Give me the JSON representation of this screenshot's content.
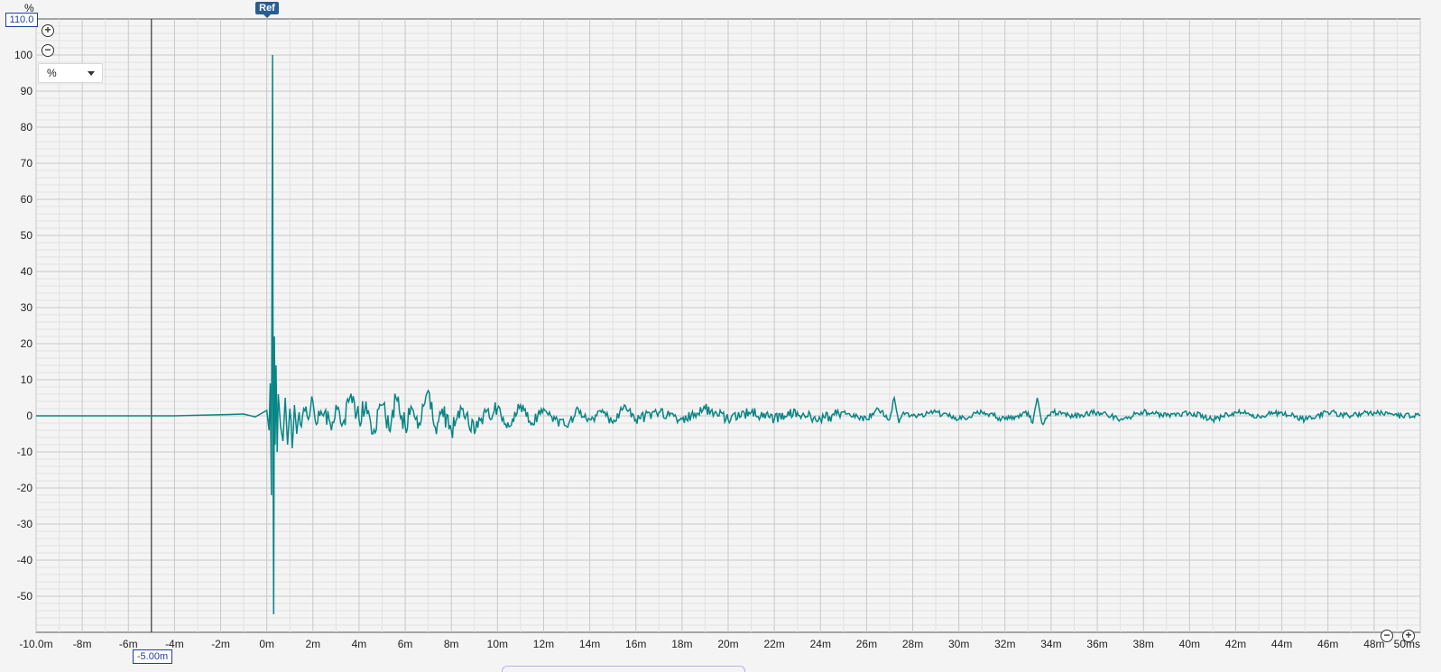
{
  "header": {
    "unit_label": "%",
    "y_max_value": "110.0",
    "ref_label": "Ref"
  },
  "controls": {
    "unit_select_value": "%",
    "zoom_in_icon": "zoom-in-icon",
    "zoom_out_icon": "zoom-out-icon"
  },
  "cursor": {
    "x_label": "-5.00m",
    "x_value": -5
  },
  "colors": {
    "trace": "#0a8585",
    "grid_major": "#c8c8c8",
    "grid_minor": "#e2e2e2",
    "axis_box": "#1f3f9f"
  },
  "chart_data": {
    "type": "line",
    "x_unit": "ms",
    "y_unit": "%",
    "xlim": [
      -10,
      50
    ],
    "ylim": [
      -60,
      110
    ],
    "x_ticks": [
      -10,
      -8,
      -6,
      -4,
      -2,
      0,
      2,
      4,
      6,
      8,
      10,
      12,
      14,
      16,
      18,
      20,
      22,
      24,
      26,
      28,
      30,
      32,
      34,
      36,
      38,
      40,
      42,
      44,
      46,
      48,
      50
    ],
    "x_tick_labels": [
      "-10.0m",
      "-8m",
      "-6m",
      "-4m",
      "-2m",
      "0m",
      "2m",
      "4m",
      "6m",
      "8m",
      "10m",
      "12m",
      "14m",
      "16m",
      "18m",
      "20m",
      "22m",
      "24m",
      "26m",
      "28m",
      "30m",
      "32m",
      "34m",
      "36m",
      "38m",
      "40m",
      "42m",
      "44m",
      "46m",
      "48m",
      "50ms"
    ],
    "y_ticks": [
      100,
      90,
      80,
      70,
      60,
      50,
      40,
      30,
      20,
      10,
      0,
      -10,
      -20,
      -30,
      -40,
      -50
    ],
    "y_tick_labels": [
      "100",
      "90",
      "80",
      "70",
      "60",
      "50",
      "40",
      "30",
      "20",
      "10",
      "0",
      "-10",
      "-20",
      "-30",
      "-40",
      "-50"
    ],
    "grid": true,
    "series": [
      {
        "x": [
          -10,
          -4,
          -2,
          -1,
          -0.5,
          0,
          0.1,
          0.15,
          0.2,
          0.22,
          0.25,
          0.28,
          0.3,
          0.33,
          0.36,
          0.4,
          0.45,
          0.5,
          0.6,
          0.7,
          0.8,
          0.9,
          1.0,
          1.1,
          1.2,
          1.3,
          1.4,
          1.5,
          1.6,
          1.8,
          2.0,
          2.2,
          2.5,
          2.8,
          3.0,
          3.3,
          3.6,
          4.0,
          4.3,
          4.6,
          5.0,
          5.3,
          5.6,
          6.0,
          6.3,
          6.6,
          7.0,
          7.3,
          7.6,
          8.0,
          8.5,
          9.0,
          9.5,
          10.0,
          10.5,
          11.0,
          11.5,
          12.0,
          12.5,
          13.0,
          13.5,
          14.0,
          14.5,
          15.0,
          15.5,
          16.0,
          17.0,
          18.0,
          19.0,
          20.0,
          21.0,
          22.0,
          23.0,
          24.0,
          25.0,
          26.0,
          26.5,
          27.0,
          27.2,
          27.4,
          27.6,
          28.0,
          29.0,
          30.0,
          31.0,
          32.0,
          33.0,
          33.2,
          33.4,
          33.6,
          34.0,
          35.0,
          36.0,
          37.0,
          38.0,
          39.0,
          40.0,
          41.0,
          42.0,
          43.0,
          44.0,
          45.0,
          46.0,
          47.0,
          48.0,
          49.0,
          50.0
        ],
        "y": [
          0,
          0,
          0.3,
          0.5,
          -0.3,
          1.5,
          -4,
          9,
          -22,
          29,
          100,
          -19,
          -55,
          22,
          -8,
          14,
          -10,
          6,
          -3,
          -7,
          5,
          -8,
          2,
          -9,
          3,
          -5,
          1,
          -3,
          2,
          -1,
          4,
          -2,
          1,
          -4,
          3,
          -2,
          5,
          -1,
          4,
          -5,
          3,
          -4,
          5,
          -3,
          2,
          -2,
          7,
          -3,
          2,
          -4,
          2,
          -5,
          1,
          2,
          -3,
          3,
          -2,
          2,
          -1,
          -3,
          2,
          -1,
          1,
          -2,
          3,
          -1,
          1,
          -1,
          2,
          -1,
          1,
          -1,
          1,
          -1,
          1,
          -1,
          2,
          -1,
          5,
          -2,
          1,
          0,
          1,
          -1,
          1,
          -1,
          1,
          -2,
          5,
          -2,
          1,
          0,
          1,
          -1,
          1,
          0,
          1,
          -1,
          1,
          0,
          1,
          -1,
          1,
          0,
          1,
          0,
          0
        ]
      }
    ]
  }
}
